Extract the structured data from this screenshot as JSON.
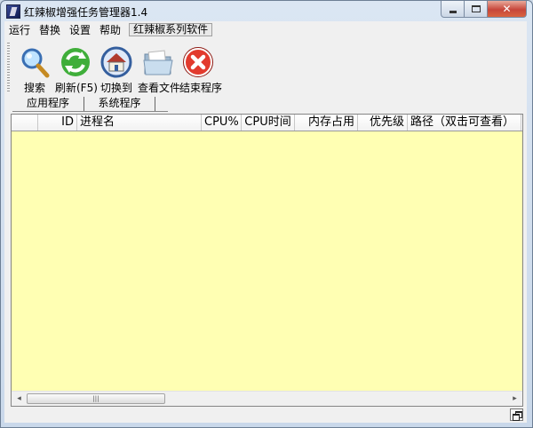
{
  "window": {
    "title": "红辣椒增强任务管理器1.4",
    "close_color": "#c7463a"
  },
  "menu": {
    "items": [
      "运行",
      "替换",
      "设置",
      "帮助"
    ],
    "boxed_item": "红辣椒系列软件"
  },
  "toolbar": {
    "buttons": [
      {
        "label": "搜索",
        "icon": "search-icon"
      },
      {
        "label": "刷新(F5)",
        "icon": "refresh-icon"
      },
      {
        "label": "切换到",
        "icon": "home-icon"
      },
      {
        "label": "查看文件",
        "icon": "folder-icon"
      },
      {
        "label": "结束程序",
        "icon": "close-icon"
      }
    ]
  },
  "tabs": [
    "应用程序",
    "系统程序"
  ],
  "table": {
    "columns": [
      "",
      "ID",
      "进程名",
      "CPU%",
      "CPU时间",
      "内存占用",
      "优先级",
      "路径（双击可查看）"
    ],
    "rows": [],
    "background": "#ffffb3"
  },
  "scrollbar": {
    "left_arrow": "◂",
    "right_arrow": "▸",
    "thumb_grip": "|||"
  }
}
